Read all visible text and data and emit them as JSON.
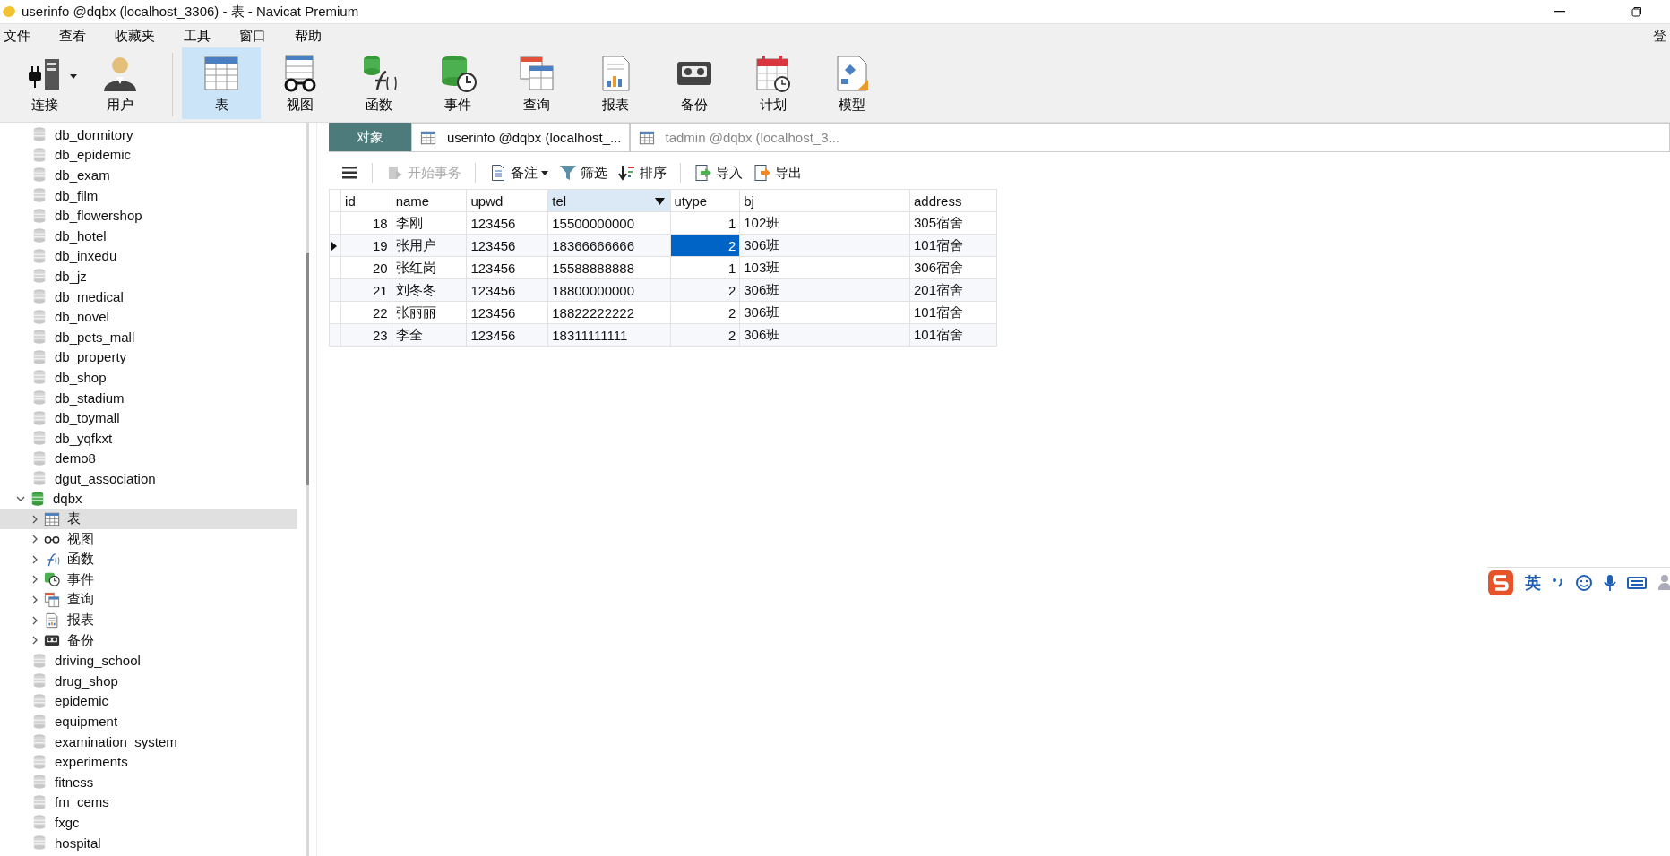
{
  "window": {
    "title": "userinfo @dqbx (localhost_3306) - 表 - Navicat Premium"
  },
  "menu": [
    "文件",
    "查看",
    "收藏夹",
    "工具",
    "窗口",
    "帮助"
  ],
  "login_label": "登",
  "toolbar": [
    {
      "kind": "connection",
      "label": "连接",
      "selected": false,
      "dropdown": true
    },
    {
      "kind": "user",
      "label": "用户",
      "selected": false,
      "dropdown": false
    },
    {
      "kind": "table",
      "label": "表",
      "selected": true,
      "dropdown": false
    },
    {
      "kind": "view",
      "label": "视图",
      "selected": false,
      "dropdown": false
    },
    {
      "kind": "function",
      "label": "函数",
      "selected": false,
      "dropdown": false
    },
    {
      "kind": "event",
      "label": "事件",
      "selected": false,
      "dropdown": false
    },
    {
      "kind": "query",
      "label": "查询",
      "selected": false,
      "dropdown": false
    },
    {
      "kind": "report",
      "label": "报表",
      "selected": false,
      "dropdown": false
    },
    {
      "kind": "backup",
      "label": "备份",
      "selected": false,
      "dropdown": false
    },
    {
      "kind": "schedule",
      "label": "计划",
      "selected": false,
      "dropdown": false
    },
    {
      "kind": "model",
      "label": "模型",
      "selected": false,
      "dropdown": false
    }
  ],
  "sidebar": {
    "items": [
      {
        "label": "db_dormitory",
        "expanded": false
      },
      {
        "label": "db_epidemic",
        "expanded": false
      },
      {
        "label": "db_exam",
        "expanded": false
      },
      {
        "label": "db_film",
        "expanded": false
      },
      {
        "label": "db_flowershop",
        "expanded": false
      },
      {
        "label": "db_hotel",
        "expanded": false
      },
      {
        "label": "db_inxedu",
        "expanded": false
      },
      {
        "label": "db_jz",
        "expanded": false
      },
      {
        "label": "db_medical",
        "expanded": false
      },
      {
        "label": "db_novel",
        "expanded": false
      },
      {
        "label": "db_pets_mall",
        "expanded": false
      },
      {
        "label": "db_property",
        "expanded": false
      },
      {
        "label": "db_shop",
        "expanded": false
      },
      {
        "label": "db_stadium",
        "expanded": false
      },
      {
        "label": "db_toymall",
        "expanded": false
      },
      {
        "label": "db_yqfkxt",
        "expanded": false
      },
      {
        "label": "demo8",
        "expanded": false
      },
      {
        "label": "dgut_association",
        "expanded": false
      },
      {
        "label": "dqbx",
        "expanded": true,
        "children": [
          {
            "kind": "table",
            "label": "表",
            "selected": true
          },
          {
            "kind": "view",
            "label": "视图",
            "selected": false
          },
          {
            "kind": "function",
            "label": "函数",
            "selected": false
          },
          {
            "kind": "event",
            "label": "事件",
            "selected": false
          },
          {
            "kind": "query",
            "label": "查询",
            "selected": false
          },
          {
            "kind": "report",
            "label": "报表",
            "selected": false
          },
          {
            "kind": "backup",
            "label": "备份",
            "selected": false
          }
        ]
      },
      {
        "label": "driving_school",
        "expanded": false
      },
      {
        "label": "drug_shop",
        "expanded": false
      },
      {
        "label": "epidemic",
        "expanded": false
      },
      {
        "label": "equipment",
        "expanded": false
      },
      {
        "label": "examination_system",
        "expanded": false
      },
      {
        "label": "experiments",
        "expanded": false
      },
      {
        "label": "fitness",
        "expanded": false
      },
      {
        "label": "fm_cems",
        "expanded": false
      },
      {
        "label": "fxgc",
        "expanded": false
      },
      {
        "label": "hospital",
        "expanded": false
      }
    ]
  },
  "tabs": [
    {
      "kind": "objects",
      "label": "对象",
      "selected": false
    },
    {
      "kind": "table",
      "label": "userinfo @dqbx (localhost_...",
      "selected": true
    },
    {
      "kind": "table",
      "label": "tadmin @dqbx (localhost_3...",
      "selected": false
    }
  ],
  "grid_toolbar": [
    {
      "kind": "menu",
      "disabled": false,
      "dropdown": false
    },
    {
      "kind": "transaction",
      "label": "开始事务",
      "disabled": true,
      "dropdown": false
    },
    {
      "kind": "memo",
      "label": "备注",
      "disabled": false,
      "dropdown": true
    },
    {
      "kind": "filter",
      "label": "筛选",
      "disabled": false,
      "dropdown": false
    },
    {
      "kind": "sort",
      "label": "排序",
      "disabled": false,
      "dropdown": false
    },
    {
      "kind": "import",
      "label": "导入",
      "disabled": false,
      "dropdown": false
    },
    {
      "kind": "export",
      "label": "导出",
      "disabled": false,
      "dropdown": false
    }
  ],
  "table": {
    "columns": [
      {
        "label": "id",
        "highlighted": false,
        "numeric": true
      },
      {
        "label": "name",
        "highlighted": false,
        "numeric": false
      },
      {
        "label": "upwd",
        "highlighted": false,
        "numeric": false
      },
      {
        "label": "tel",
        "highlighted": true,
        "numeric": false
      },
      {
        "label": "utype",
        "highlighted": false,
        "numeric": true
      },
      {
        "label": "bj",
        "highlighted": false,
        "numeric": false
      },
      {
        "label": "address",
        "highlighted": false,
        "numeric": false
      }
    ],
    "rows": [
      {
        "current": false,
        "cells": [
          {
            "text": "18",
            "selected": false
          },
          {
            "text": "李刚",
            "selected": false
          },
          {
            "text": "123456",
            "selected": false
          },
          {
            "text": "15500000000",
            "selected": false
          },
          {
            "text": "1",
            "selected": false
          },
          {
            "text": "102班",
            "selected": false
          },
          {
            "text": "305宿舍",
            "selected": false
          }
        ]
      },
      {
        "current": true,
        "cells": [
          {
            "text": "19",
            "selected": false
          },
          {
            "text": "张用户",
            "selected": false
          },
          {
            "text": "123456",
            "selected": false
          },
          {
            "text": "18366666666",
            "selected": false
          },
          {
            "text": "2",
            "selected": true
          },
          {
            "text": "306班",
            "selected": false
          },
          {
            "text": "101宿舍",
            "selected": false
          }
        ]
      },
      {
        "current": false,
        "cells": [
          {
            "text": "20",
            "selected": false
          },
          {
            "text": "张红岗",
            "selected": false
          },
          {
            "text": "123456",
            "selected": false
          },
          {
            "text": "15588888888",
            "selected": false
          },
          {
            "text": "1",
            "selected": false
          },
          {
            "text": "103班",
            "selected": false
          },
          {
            "text": "306宿舍",
            "selected": false
          }
        ]
      },
      {
        "current": false,
        "cells": [
          {
            "text": "21",
            "selected": false
          },
          {
            "text": "刘冬冬",
            "selected": false
          },
          {
            "text": "123456",
            "selected": false
          },
          {
            "text": "18800000000",
            "selected": false
          },
          {
            "text": "2",
            "selected": false
          },
          {
            "text": "306班",
            "selected": false
          },
          {
            "text": "201宿舍",
            "selected": false
          }
        ]
      },
      {
        "current": false,
        "cells": [
          {
            "text": "22",
            "selected": false
          },
          {
            "text": "张丽丽",
            "selected": false
          },
          {
            "text": "123456",
            "selected": false
          },
          {
            "text": "18822222222",
            "selected": false
          },
          {
            "text": "2",
            "selected": false
          },
          {
            "text": "306班",
            "selected": false
          },
          {
            "text": "101宿舍",
            "selected": false
          }
        ]
      },
      {
        "current": false,
        "cells": [
          {
            "text": "23",
            "selected": false
          },
          {
            "text": "李全",
            "selected": false
          },
          {
            "text": "123456",
            "selected": false
          },
          {
            "text": "18311111111",
            "selected": false
          },
          {
            "text": "2",
            "selected": false
          },
          {
            "text": "306班",
            "selected": false
          },
          {
            "text": "101宿舍",
            "selected": false
          }
        ]
      }
    ]
  },
  "ime_bar": {
    "label": "英"
  }
}
